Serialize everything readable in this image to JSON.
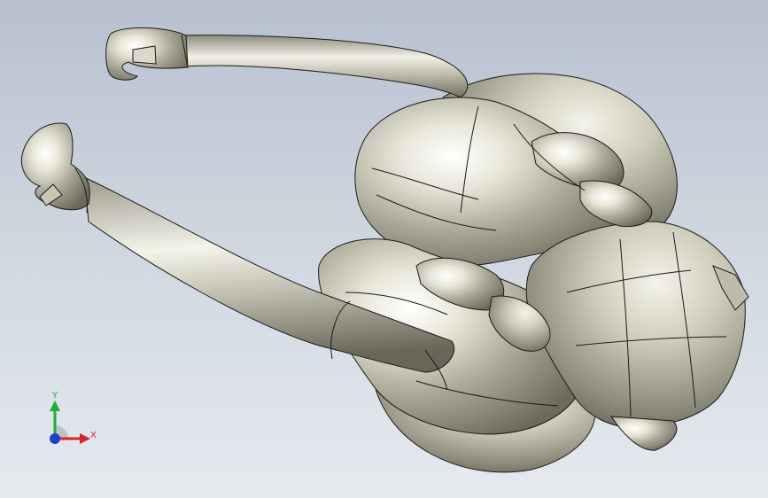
{
  "viewport": {
    "background_top": "#b7c1cf",
    "background_bottom": "#e6eaef",
    "model_color": "#c9c8b6",
    "edge_color": "#1a1a1a"
  },
  "triad": {
    "y_label": "Y",
    "x_label": "X",
    "y_color": "#1fae3a",
    "x_color": "#d1262b",
    "z_color": "#1f3fd1",
    "icons": [
      "y-axis-arrow-icon",
      "x-axis-arrow-icon",
      "z-axis-dot-icon"
    ]
  }
}
